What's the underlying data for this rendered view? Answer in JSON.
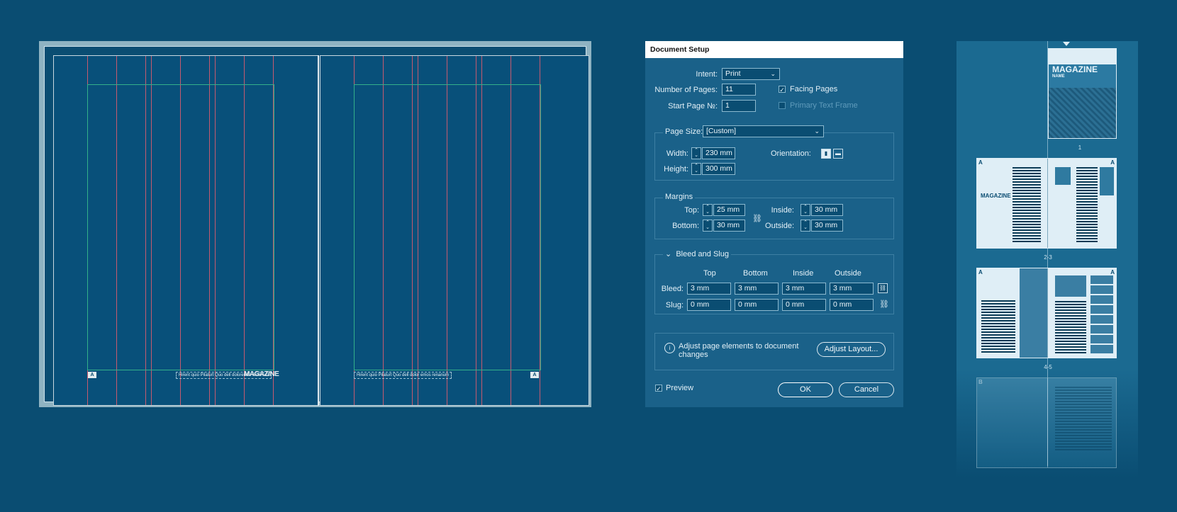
{
  "spread": {
    "left_footer_text": "Hirent quio Pilaturt Quo dell dolorenda renanum",
    "right_footer_text": "Hirent quio Pilaturt Quo dell dolor emos renanum",
    "left_page_marker": "A",
    "right_page_marker": "A",
    "left_logo": "MAGAZINE"
  },
  "dialog": {
    "title": "Document Setup",
    "intent_label": "Intent:",
    "intent_value": "Print",
    "pages_label": "Number of Pages:",
    "pages_value": "11",
    "start_label": "Start Page №:",
    "start_value": "1",
    "facing_pages": "Facing Pages",
    "primary_text_frame": "Primary Text Frame",
    "page_size_label": "Page Size:",
    "page_size_value": "[Custom]",
    "width_label": "Width:",
    "width_value": "230 mm",
    "height_label": "Height:",
    "height_value": "300 mm",
    "orientation_label": "Orientation:",
    "margins_title": "Margins",
    "top_label": "Top:",
    "top_value": "25 mm",
    "bottom_label": "Bottom:",
    "bottom_value": "30 mm",
    "inside_label": "Inside:",
    "inside_value": "30 mm",
    "outside_label": "Outside:",
    "outside_value": "30 mm",
    "bleed_slug_title": "Bleed and Slug",
    "col_top": "Top",
    "col_bottom": "Bottom",
    "col_inside": "Inside",
    "col_outside": "Outside",
    "bleed_label": "Bleed:",
    "bleed_top": "3 mm",
    "bleed_bottom": "3 mm",
    "bleed_inside": "3 mm",
    "bleed_outside": "3 mm",
    "slug_label": "Slug:",
    "slug_top": "0 mm",
    "slug_bottom": "0 mm",
    "slug_inside": "0 mm",
    "slug_outside": "0 mm",
    "adjust_text_1": "Adjust page elements to document",
    "adjust_text_2": "changes",
    "adjust_button": "Adjust Layout...",
    "preview": "Preview",
    "ok": "OK",
    "cancel": "Cancel"
  },
  "pages_panel": {
    "cover_title": "MAGAZINE",
    "cover_sub": "NAME",
    "labels": [
      "1",
      "2-3",
      "4-5"
    ],
    "master_marker": "A",
    "master_marker_b": "B"
  }
}
